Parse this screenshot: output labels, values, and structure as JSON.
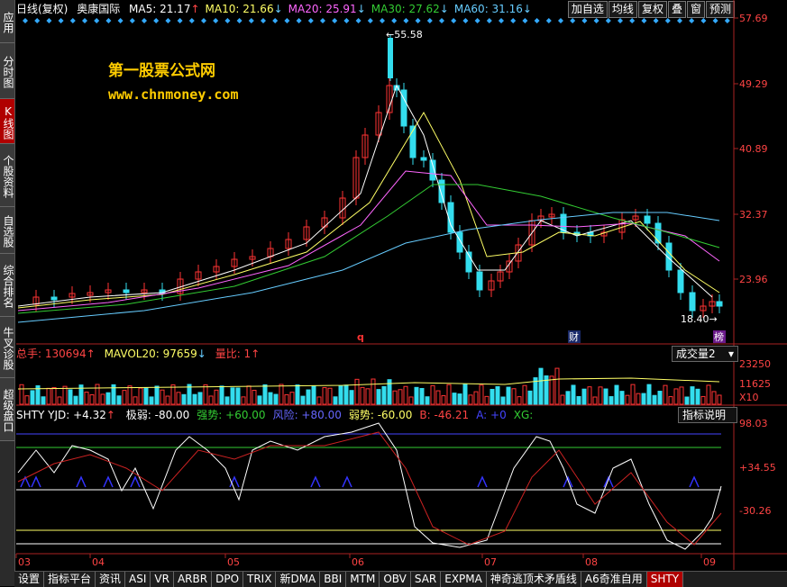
{
  "sidebar": [
    "应用",
    "分时图",
    "K线图",
    "个股资料",
    "自选股",
    "综合排名",
    "牛叉诊股",
    "超级盘口"
  ],
  "sidebar_active": 2,
  "header": {
    "period": "日线(复权)",
    "stock": "奥康国际",
    "ma": [
      {
        "label": "MA5: 21.17",
        "arrow": "↑",
        "color": "#ffffff"
      },
      {
        "label": "MA10: 21.66",
        "arrow": "↓",
        "color": "#ffff66"
      },
      {
        "label": "MA20: 25.91",
        "arrow": "↓",
        "color": "#ff66ff"
      },
      {
        "label": "MA30: 27.62",
        "arrow": "↓",
        "color": "#33cc33"
      },
      {
        "label": "MA60: 31.16",
        "arrow": "↓",
        "color": "#66ccff"
      }
    ]
  },
  "toolbar": [
    "加自选",
    "均线",
    "复权",
    "叠",
    "窗",
    "预测"
  ],
  "price_axis": [
    "57.69",
    "49.29",
    "40.89",
    "32.37",
    "23.96"
  ],
  "high_label": "55.58",
  "low_label": "18.40",
  "markers": {
    "q": "q",
    "cai": "财",
    "bang": "榜"
  },
  "volume": {
    "total": "总手: 130694",
    "total_arrow": "↑",
    "mavol": "MAVOL20: 97659",
    "mavol_arrow": "↓",
    "ratio": "量比: 1",
    "ratio_arrow": "↑",
    "dropdown": "成交量2",
    "axis": [
      "23250",
      "11625",
      "X10"
    ]
  },
  "indicator": {
    "name": "SHTY YJD: +4.32",
    "name_arrow": "↑",
    "items": [
      {
        "label": "极弱: -80.00",
        "color": "#ffffff"
      },
      {
        "label": "强势: +60.00",
        "color": "#33cc33"
      },
      {
        "label": "风险: +80.00",
        "color": "#6666ff"
      },
      {
        "label": "弱势: -60.00",
        "color": "#ffff66"
      },
      {
        "label": "B: -46.21",
        "color": "#ff4444"
      },
      {
        "label": "A: +0",
        "color": "#4444ff"
      },
      {
        "label": "XG:",
        "color": "#33cc33"
      }
    ],
    "help": "指标说明",
    "axis": [
      "98.03",
      "+34.55",
      "-30.26"
    ]
  },
  "x_axis": [
    "03",
    "04",
    "05",
    "06",
    "07",
    "08",
    "09"
  ],
  "bottom_tabs": [
    "设置",
    "指标平台",
    "资讯",
    "ASI",
    "VR",
    "ARBR",
    "DPO",
    "TRIX",
    "新DMA",
    "BBI",
    "MTM",
    "OBV",
    "SAR",
    "EXPMA",
    "神奇逃顶术矛盾线",
    "A6奇准自用",
    "SHTY"
  ],
  "watermark": {
    "line1": "第一股票公式网",
    "line2": "www.chnmoney.com"
  }
}
